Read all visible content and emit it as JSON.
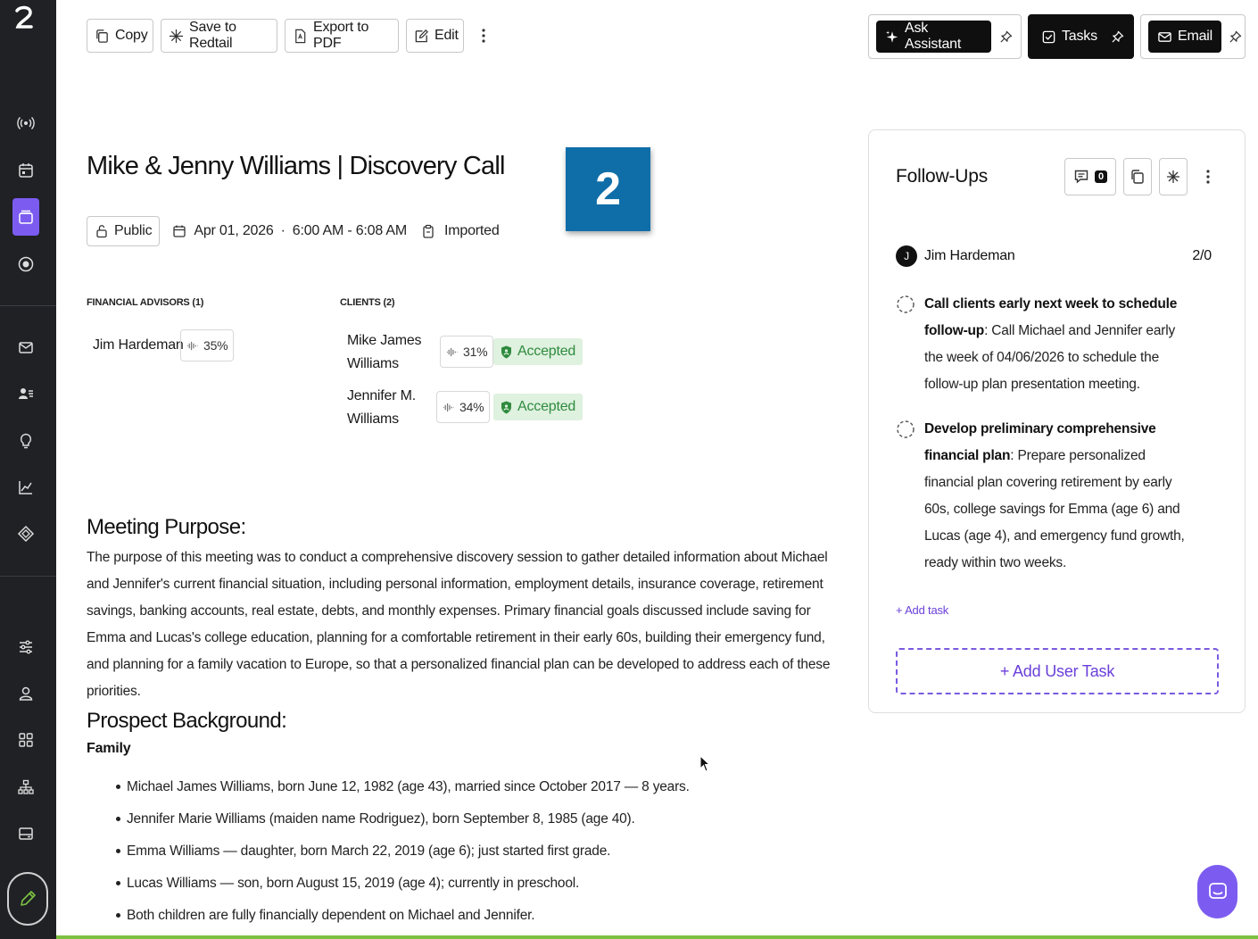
{
  "toolbar": {
    "copy_label": "Copy",
    "redtail_label": "Save to Redtail",
    "pdf_label": "Export to PDF",
    "edit_label": "Edit",
    "assistant_label": "Ask Assistant",
    "tasks_label": "Tasks",
    "email_label": "Email"
  },
  "meeting": {
    "title": "Mike & Jenny Williams | Discovery Call",
    "overlay_number": "2",
    "visibility": "Public",
    "date": "Apr 01, 2026",
    "separator": "·",
    "time": "6:00 AM - 6:08 AM",
    "source": "Imported"
  },
  "advisors": {
    "label": "FINANCIAL ADVISORS (1)",
    "items": [
      {
        "name": "Jim Hardeman",
        "talk_pct": "35%"
      }
    ]
  },
  "clients": {
    "label": "CLIENTS (2)",
    "items": [
      {
        "name_line1": "Mike James",
        "name_line2": "Williams",
        "talk_pct": "31%",
        "status": "Accepted"
      },
      {
        "name_line1": "Jennifer M.",
        "name_line2": "Williams",
        "talk_pct": "34%",
        "status": "Accepted"
      }
    ]
  },
  "purpose": {
    "heading": "Meeting Purpose:",
    "text": "The purpose of this meeting was to conduct a comprehensive discovery session to gather detailed information about Michael and Jennifer's current financial situation, including personal information, employment details, insurance coverage, retirement savings, banking accounts, real estate, debts, and monthly expenses. Primary financial goals discussed include saving for Emma and Lucas's college education, planning for a comfortable retirement in their early 60s, building their emergency fund, and planning for a family vacation to Europe, so that a personalized financial plan can be developed to address each of these priorities."
  },
  "background": {
    "heading": "Prospect Background:",
    "subheading": "Family",
    "items": [
      "Michael James Williams, born June 12, 1982 (age 43), married since October 2017 — 8 years.",
      "Jennifer Marie Williams (maiden name Rodriguez), born September 8, 1985 (age 40).",
      "Emma Williams — daughter, born March 22, 2019 (age 6); just started first grade.",
      "Lucas Williams — son, born August 15, 2019 (age 4); currently in preschool.",
      "Both children are fully financially dependent on Michael and Jennifer."
    ]
  },
  "followups": {
    "title": "Follow-Ups",
    "comment_count": "0",
    "owner_initial": "J",
    "owner_name": "Jim Hardeman",
    "owner_count": "2/0",
    "tasks": [
      {
        "title": "Call clients early next week to schedule follow-up",
        "desc": ": Call Michael and Jennifer early the week of 04/06/2026 to schedule the follow-up plan presentation meeting."
      },
      {
        "title": "Develop preliminary comprehensive financial plan",
        "desc": ": Prepare personalized financial plan covering retirement by early 60s, college savings for Emma (age 6) and Lucas (age 4), and emergency fund growth, ready within two weeks."
      }
    ],
    "add_task_label": "+ Add task",
    "add_user_task_label": "+ Add User Task"
  },
  "colors": {
    "accent": "#7c5cf0",
    "sidebar": "#1f2125",
    "accepted_bg": "#dff1df",
    "accepted_fg": "#2e8b3e",
    "overlay_badge": "#0f6ea8"
  }
}
